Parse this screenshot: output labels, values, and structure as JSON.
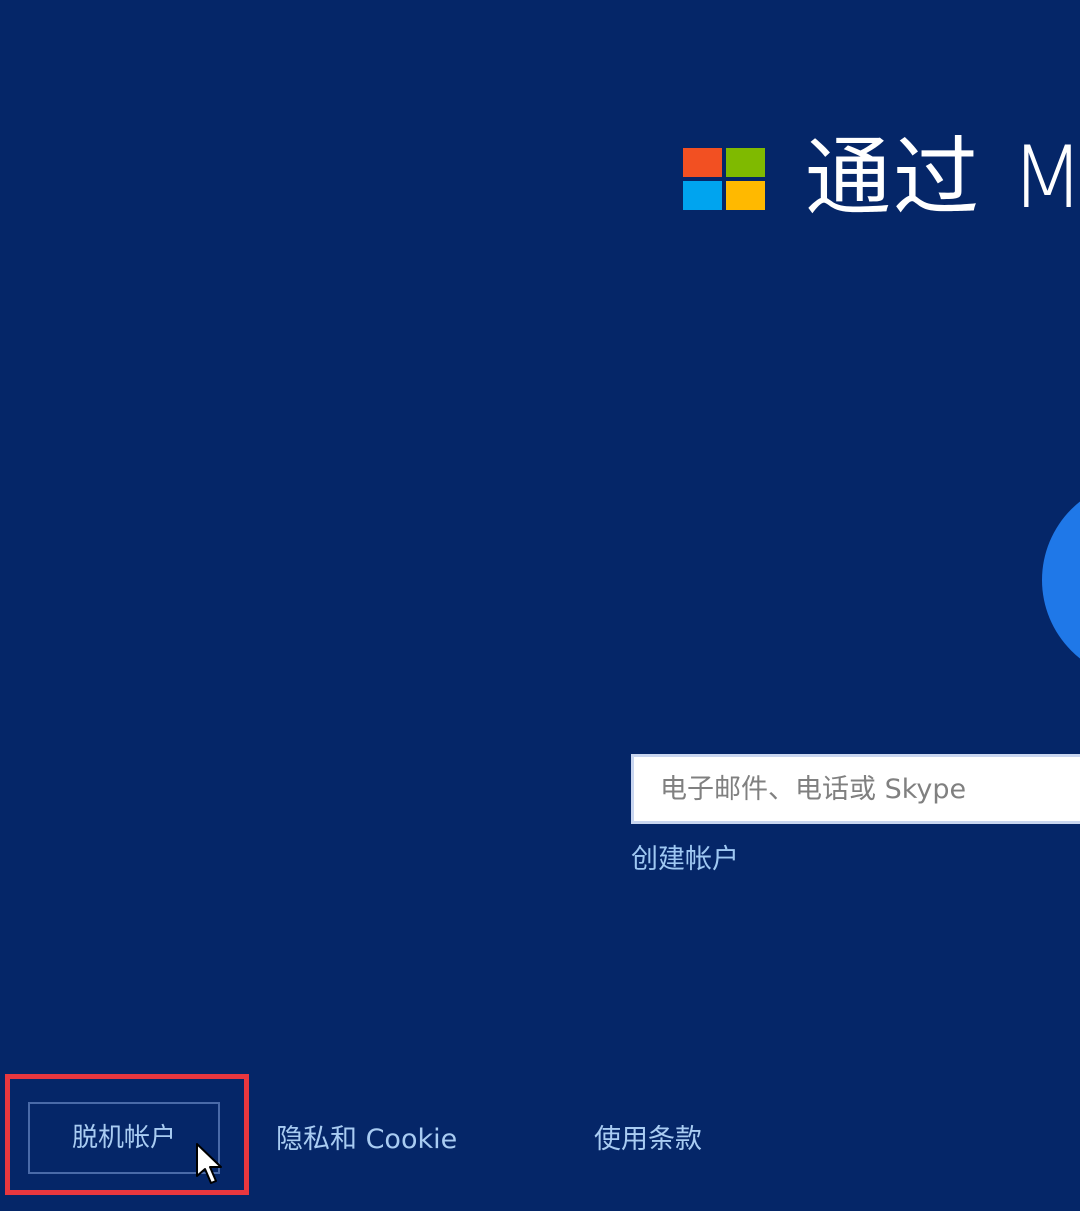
{
  "colors": {
    "background": "#052668",
    "accent_circle": "#1f78e8",
    "link": "#a9ccf2",
    "highlight_box": "#e8373f"
  },
  "header": {
    "logo": {
      "icon": "microsoft-logo-icon",
      "colors": [
        "#f25022",
        "#7fba00",
        "#00a4ef",
        "#ffb900"
      ]
    },
    "title": "通过 M"
  },
  "signin": {
    "email_placeholder": "电子邮件、电话或 Skype",
    "create_account_label": "创建帐户"
  },
  "footer": {
    "offline_account_label": "脱机帐户",
    "privacy_label": "隐私和 Cookie",
    "terms_label": "使用条款"
  },
  "cursor": {
    "icon": "mouse-pointer-icon"
  }
}
